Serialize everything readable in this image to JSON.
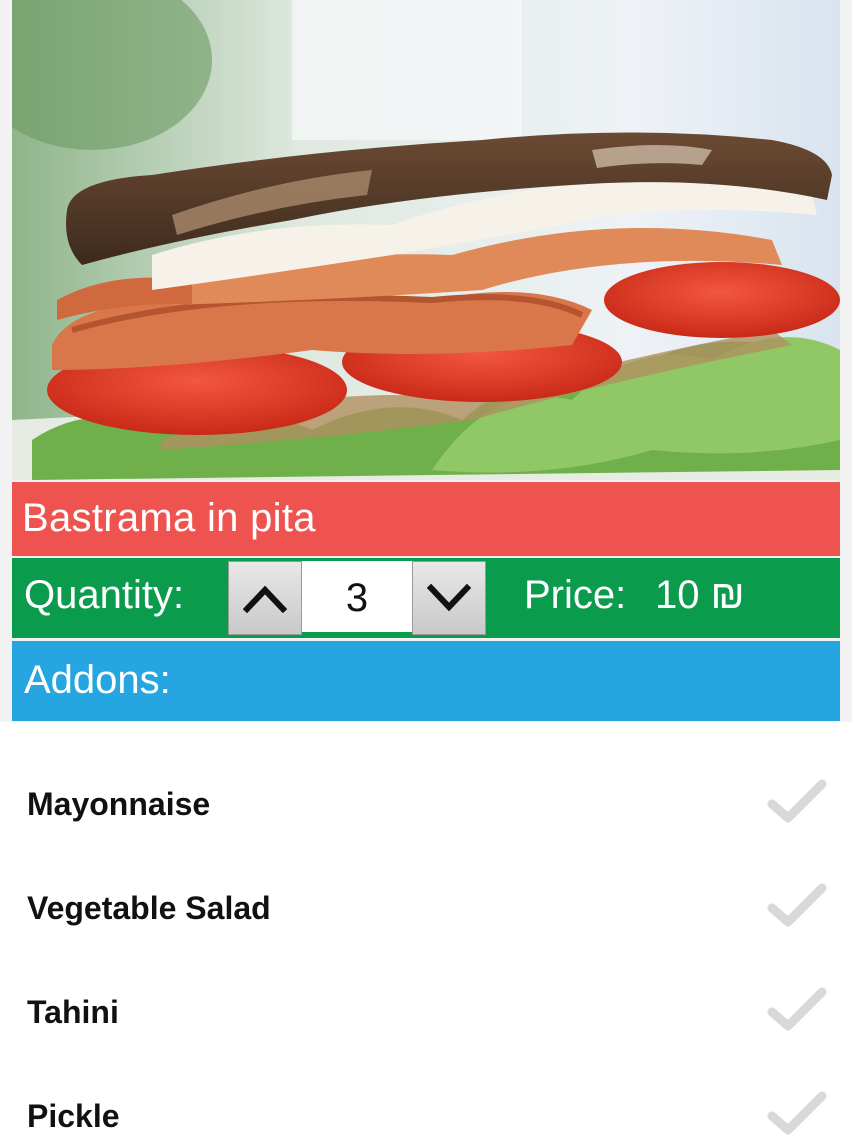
{
  "product": {
    "image_icon": "sandwich-photo",
    "title": "Bastrama in pita"
  },
  "quantity": {
    "label": "Quantity:",
    "value": "3",
    "increment_icon": "chevron-up-icon",
    "decrement_icon": "chevron-down-icon"
  },
  "price": {
    "label": "Price:",
    "value": "10 ₪"
  },
  "addons": {
    "header": "Addons:",
    "check_icon": "checkmark-icon",
    "items": [
      {
        "label": "Mayonnaise"
      },
      {
        "label": "Vegetable Salad"
      },
      {
        "label": "Tahini"
      },
      {
        "label": "Pickle"
      }
    ]
  },
  "colors": {
    "title_bar": "#ef5350",
    "quantity_bar": "#0b9b4c",
    "addons_bar": "#26a6e1",
    "check_inactive": "#d8d8d8"
  }
}
